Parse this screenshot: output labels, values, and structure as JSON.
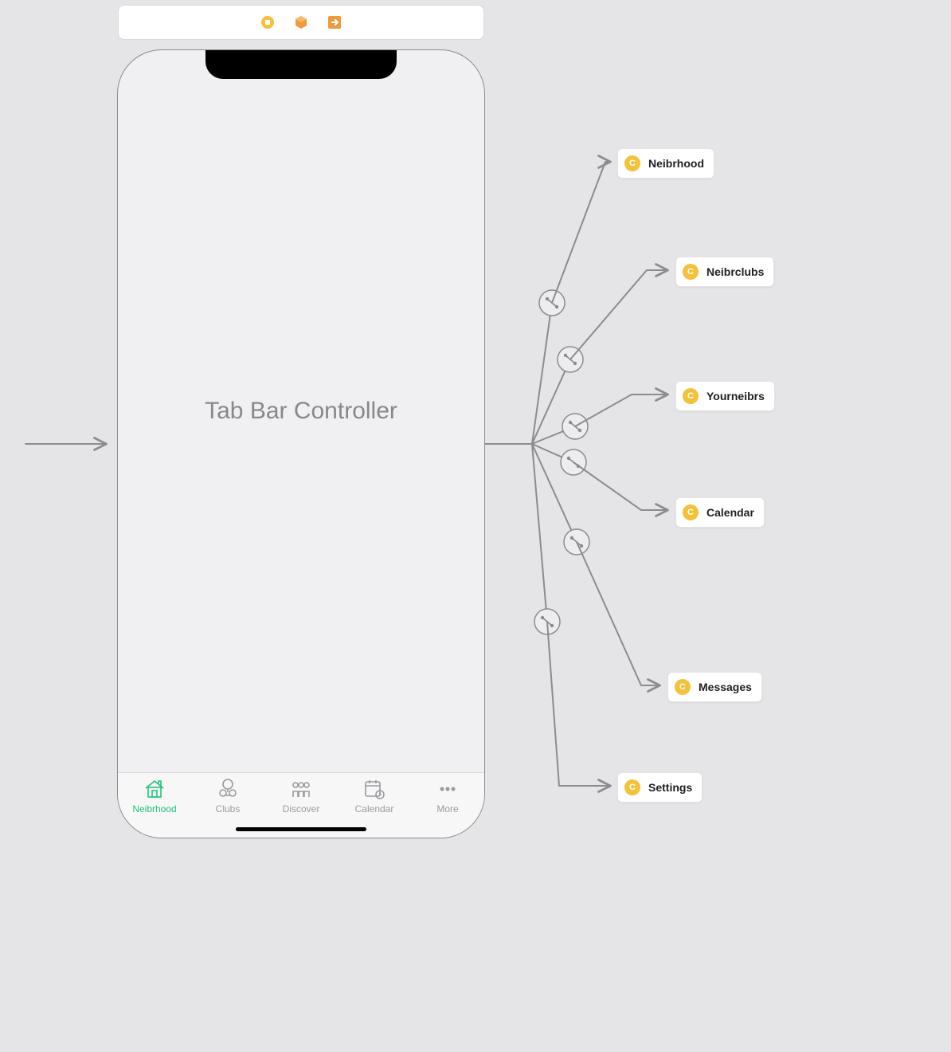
{
  "toolbar": {
    "icons": [
      "storyboard-entry-icon",
      "scene-icon",
      "exit-icon"
    ]
  },
  "device": {
    "title": "Tab Bar Controller",
    "tabs": [
      {
        "label": "Neibrhood",
        "icon": "house-icon",
        "active": true
      },
      {
        "label": "Clubs",
        "icon": "clubs-icon",
        "active": false
      },
      {
        "label": "Discover",
        "icon": "discover-icon",
        "active": false
      },
      {
        "label": "Calendar",
        "icon": "calendar-icon",
        "active": false
      },
      {
        "label": "More",
        "icon": "more-icon",
        "active": false
      }
    ]
  },
  "segues": [
    {
      "label": "Neibrhood"
    },
    {
      "label": "Neibrclubs"
    },
    {
      "label": "Yourneibrs"
    },
    {
      "label": "Calendar"
    },
    {
      "label": "Messages"
    },
    {
      "label": "Settings"
    }
  ]
}
